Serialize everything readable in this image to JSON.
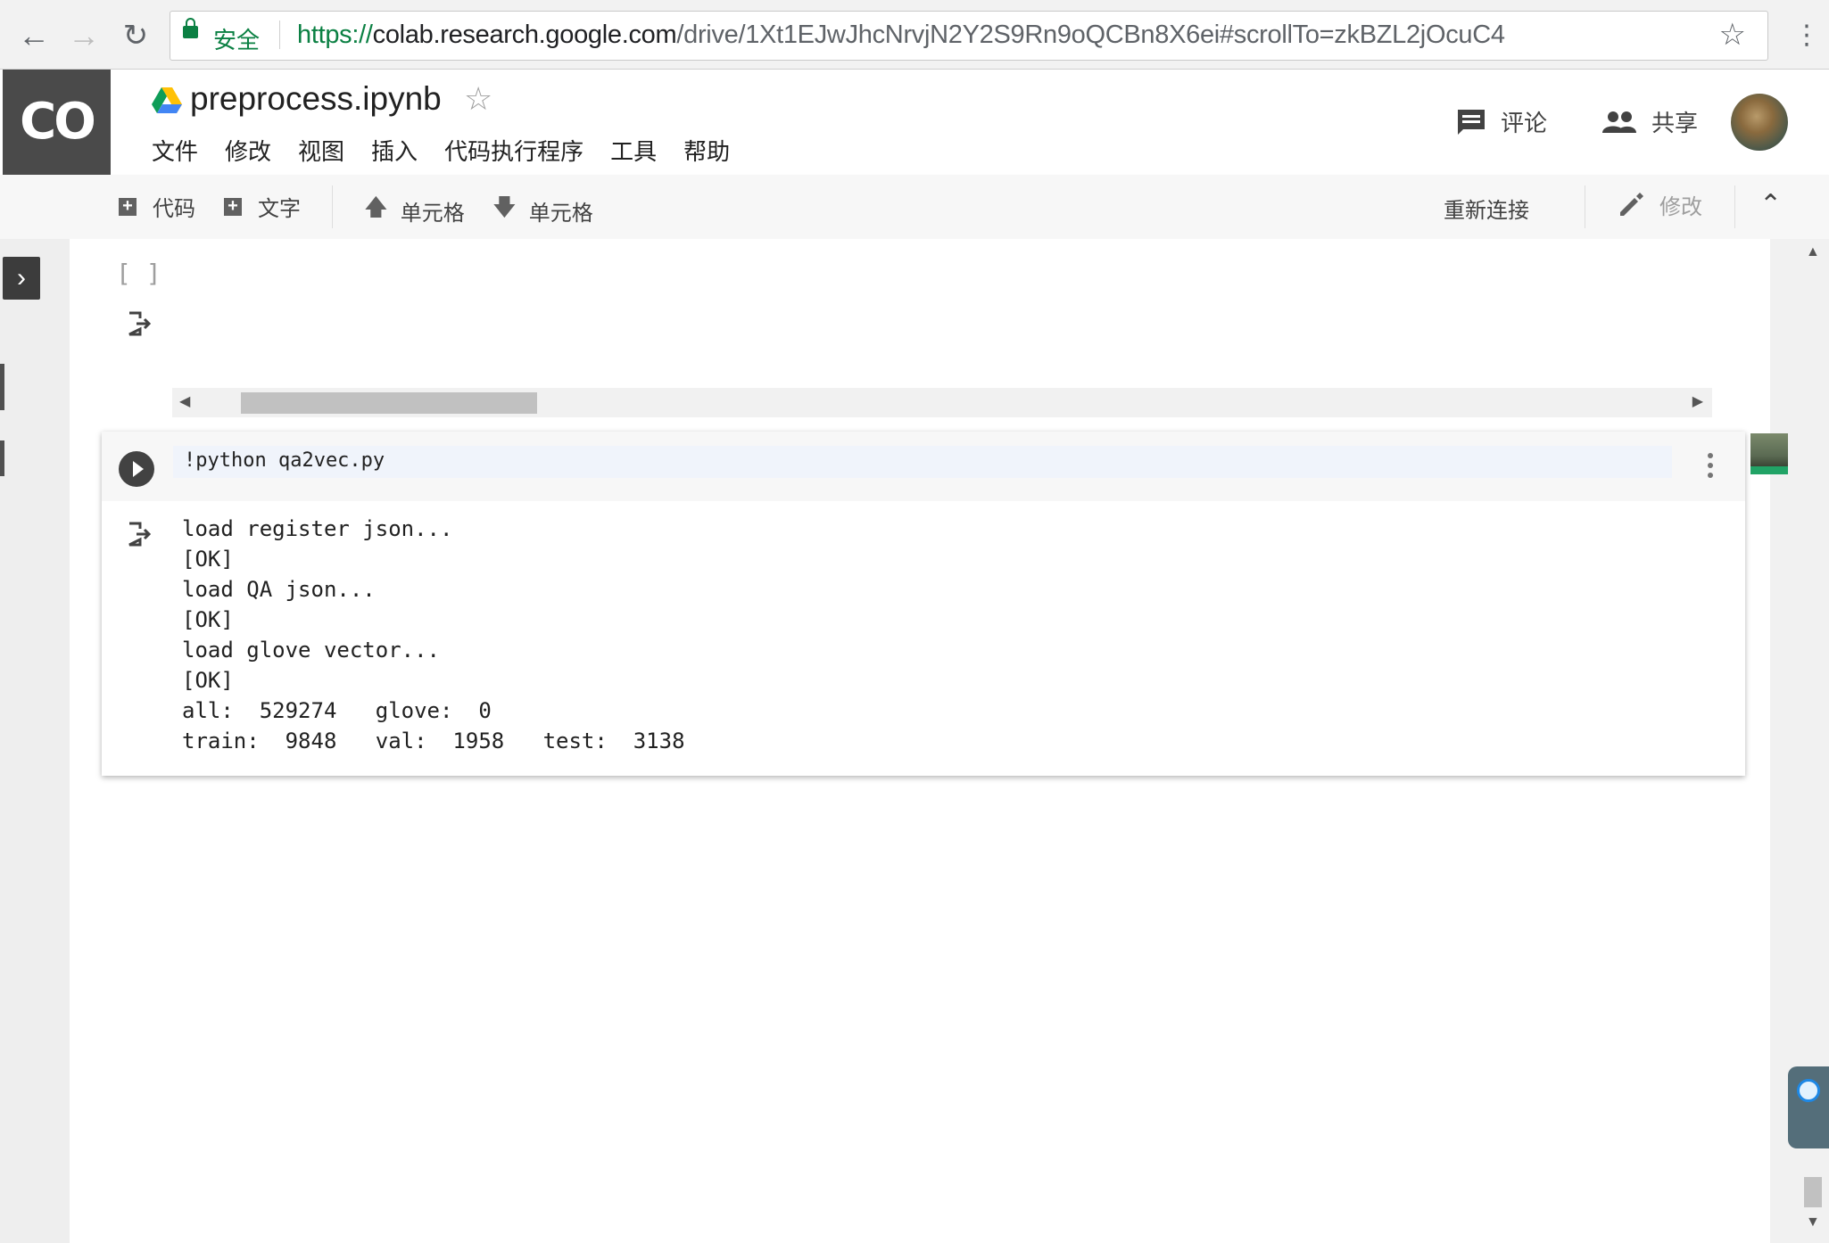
{
  "browser": {
    "secure_label": "安全",
    "url_scheme": "https://",
    "url_host": "colab.research.google.com",
    "url_path": "/drive/1Xt1EJwJhcNrvjN2Y2S9Rn9oQCBn8X6ei#scrollTo=zkBZL2jOcuC4"
  },
  "header": {
    "logo_text": "CO",
    "notebook_title": "preprocess.ipynb",
    "menu": [
      "文件",
      "修改",
      "视图",
      "插入",
      "代码执行程序",
      "工具",
      "帮助"
    ],
    "comment_label": "评论",
    "share_label": "共享"
  },
  "toolbar": {
    "add_code_label": "代码",
    "add_text_label": "文字",
    "move_up_label": "单元格",
    "move_down_label": "单元格",
    "reconnect_label": "重新连接",
    "edit_label": "修改"
  },
  "cells": {
    "cell1_bracket": "[ ]",
    "cell2_code": "!python qa2vec.py",
    "cell2_output": "load register json...\n[OK]\nload QA json...\n[OK]\nload glove vector...\n[OK]\nall:  529274   glove:  0\ntrain:  9848   val:  1958   test:  3138"
  },
  "colors": {
    "logo_bg": "#4a4a4a",
    "secure_green": "#0b8043",
    "code_bg": "#f0f4fb"
  }
}
